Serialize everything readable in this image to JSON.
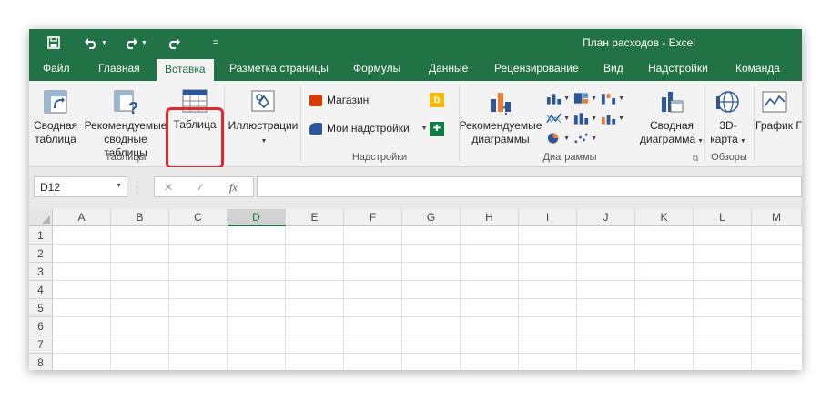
{
  "window_title": "План расходов - Excel",
  "qat": {
    "save_icon": "save-icon",
    "undo_icon": "undo-icon",
    "redo_icon": "redo-icon",
    "repeat_icon": "repeat-icon",
    "customize_label": "="
  },
  "tabs": [
    {
      "label": "Файл",
      "active": false
    },
    {
      "label": "Главная",
      "active": false
    },
    {
      "label": "Вставка",
      "active": true
    },
    {
      "label": "Разметка страницы",
      "active": false
    },
    {
      "label": "Формулы",
      "active": false
    },
    {
      "label": "Данные",
      "active": false
    },
    {
      "label": "Рецензирование",
      "active": false
    },
    {
      "label": "Вид",
      "active": false
    },
    {
      "label": "Надстройки",
      "active": false
    },
    {
      "label": "Команда",
      "active": false
    }
  ],
  "ribbon": {
    "tables": {
      "group_label": "Таблицы",
      "pivot_line1": "Сводная",
      "pivot_line2": "таблица",
      "recommended_line1": "Рекомендуемые",
      "recommended_line2": "сводные таблицы",
      "table_label": "Таблица"
    },
    "illustrations": {
      "label": "Иллюстрации"
    },
    "addins": {
      "group_label": "Надстройки",
      "store_label": "Магазин",
      "my_addins_label": "Мои надстройки"
    },
    "charts": {
      "group_label": "Диаграммы",
      "recommended_line1": "Рекомендуемые",
      "recommended_line2": "диаграммы",
      "pivot_chart_line1": "Сводная",
      "pivot_chart_line2": "диаграмма"
    },
    "tours": {
      "group_label": "Обзоры",
      "map_line1": "3D-",
      "map_line2": "карта"
    },
    "sparklines": {
      "graph_label": "График",
      "graph_extra": "Г"
    }
  },
  "formula_bar": {
    "name_box": "D12",
    "cancel_symbol": "✕",
    "enter_symbol": "✓",
    "fx_symbol": "fx",
    "value": ""
  },
  "sheet": {
    "columns": [
      "A",
      "B",
      "C",
      "D",
      "E",
      "F",
      "G",
      "H",
      "I",
      "J",
      "K",
      "L",
      "M"
    ],
    "selected_column": "D",
    "rows": [
      "1",
      "2",
      "3",
      "4",
      "5",
      "6",
      "7",
      "8"
    ]
  },
  "colors": {
    "excel_green": "#217346",
    "highlight_red": "#e0262e"
  }
}
